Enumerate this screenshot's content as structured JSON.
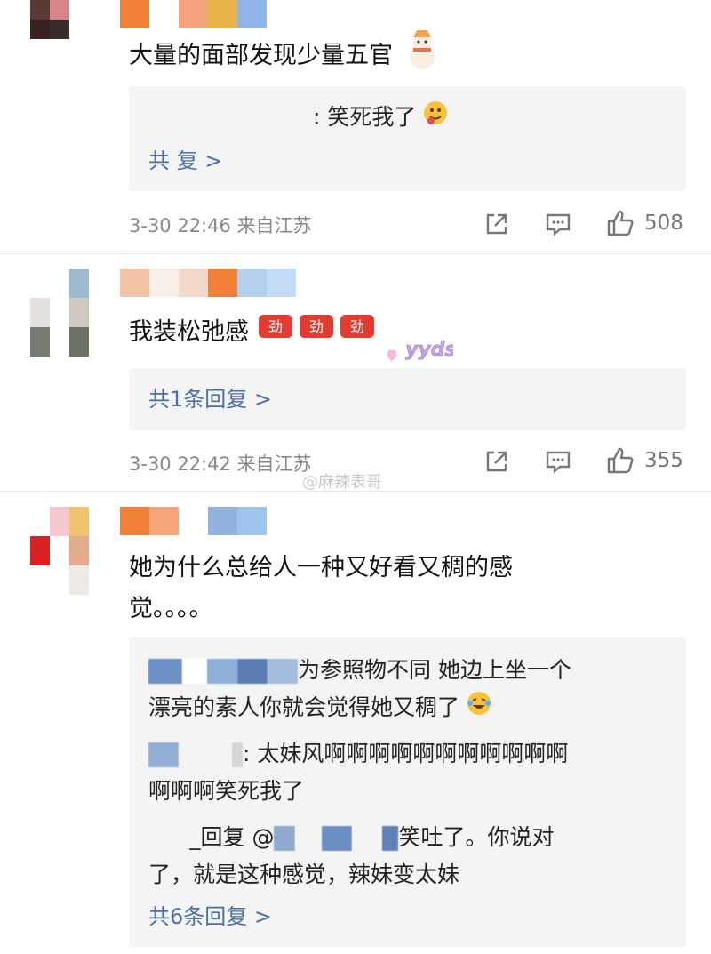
{
  "comments": [
    {
      "text": "大量的面部发现少量五官",
      "replies": [
        ": 笑死我了"
      ],
      "reply_count_label": "共  复 >",
      "timestamp": "3-30 22:46 来自江苏",
      "like_count": "508"
    },
    {
      "text": "我装松弛感",
      "emoji_label": "yyds",
      "reply_count_label": "共1条回复 >",
      "timestamp": "3-30 22:42 来自江苏",
      "like_count": "355"
    },
    {
      "text_line1": "她为什么总给人一种又好看又稠的感",
      "text_line2": "觉。。。。",
      "replies": [
        "为参照物不同 她边上坐一个",
        "漂亮的素人你就会觉得她又稠了",
        ": 太妹风啊啊啊啊啊啊啊啊啊啊啊",
        "啊啊啊笑死我了",
        "_回复 @",
        "笑吐了。你说对",
        "了，就是这种感觉，辣妹变太妹"
      ],
      "reply_count_label": "共6条回复 >"
    }
  ],
  "watermark": "@麻辣表哥",
  "colors": {
    "link": "#4b6ea8",
    "meta": "#888888",
    "reply_bg": "#f4f4f4"
  }
}
